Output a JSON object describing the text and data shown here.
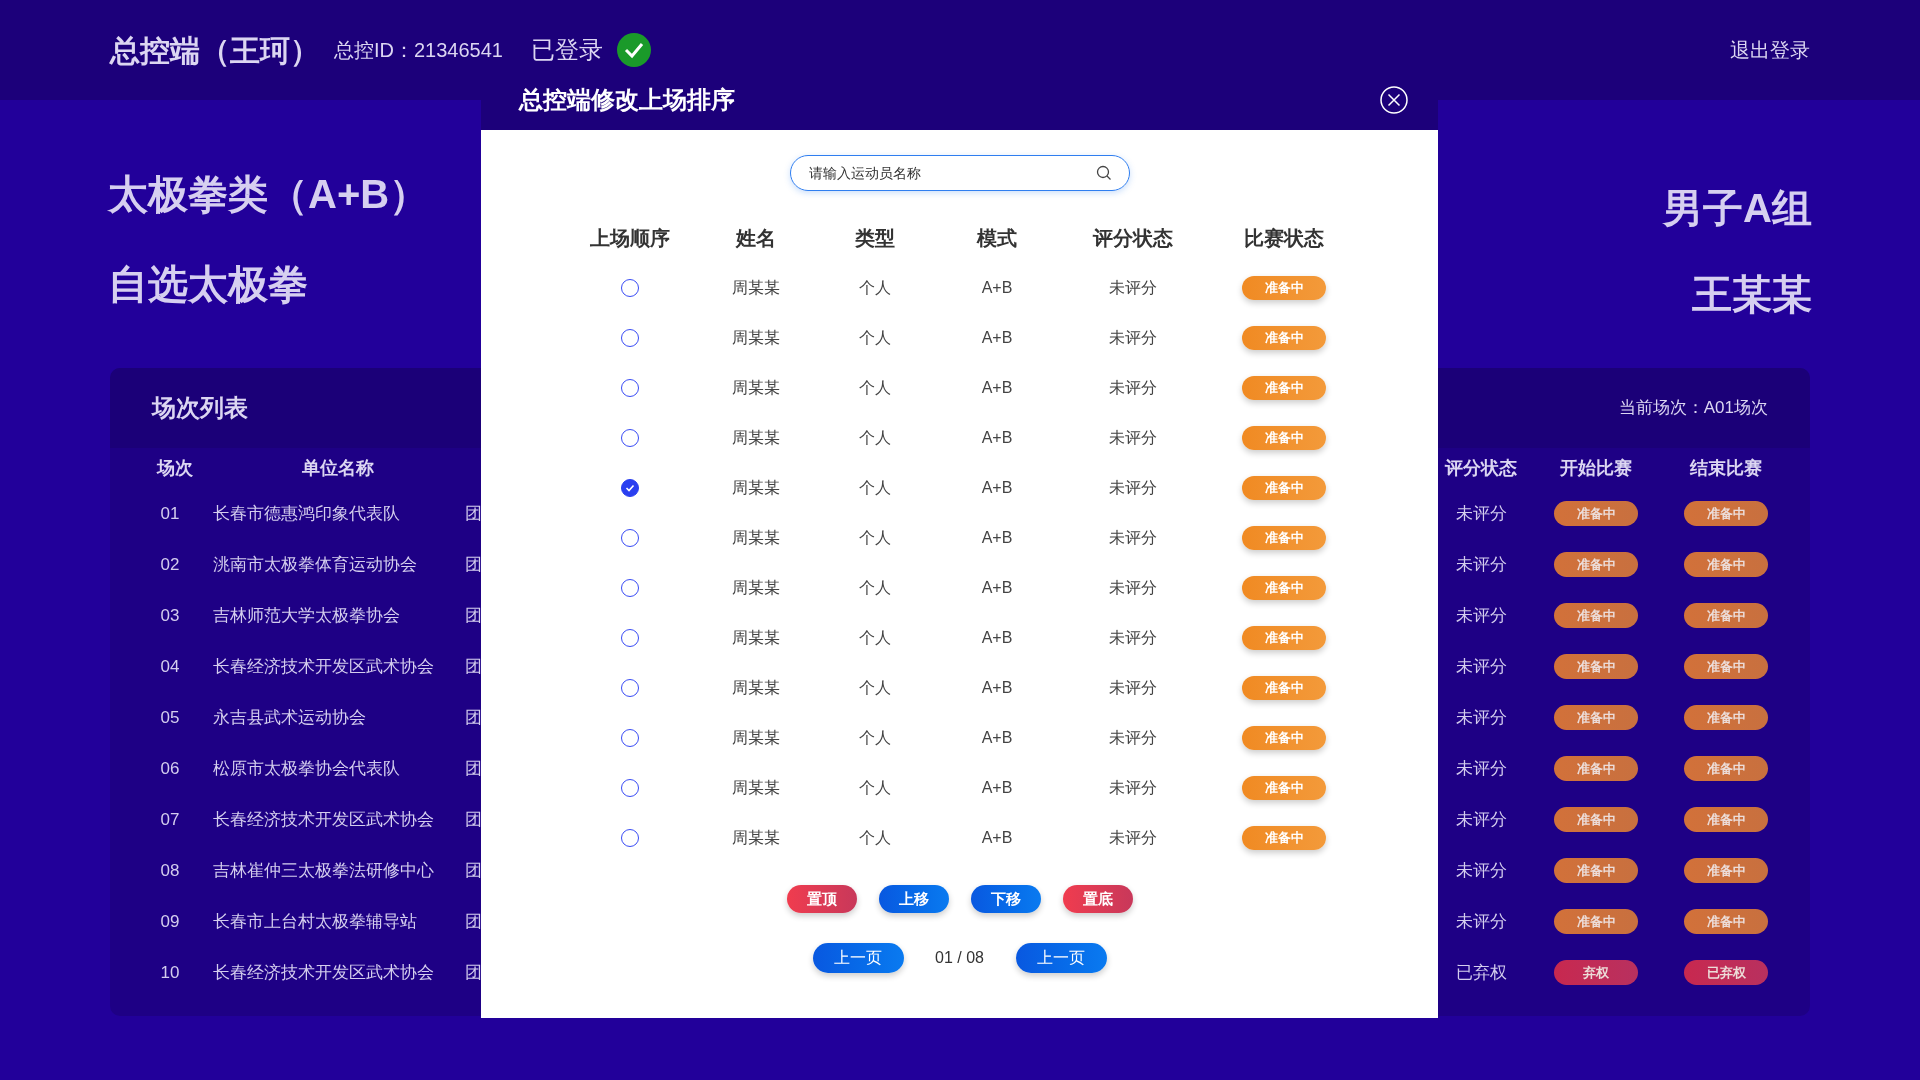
{
  "header": {
    "title": "总控端（王珂）",
    "id_label": "总控ID：21346541",
    "login_status": "已登录",
    "logout": "退出登录"
  },
  "event": {
    "category": "太极拳类（A+B）",
    "routine": "自选太极拳",
    "group": "男子A组",
    "athlete": "王某某"
  },
  "panel": {
    "title": "场次列表",
    "current": "当前场次：A01场次",
    "left_columns": [
      "场次",
      "单位名称"
    ],
    "right_columns": [
      "评分状态",
      "开始比赛",
      "结束比赛"
    ],
    "rows": [
      {
        "no": "01",
        "unit": "长春市德惠鸿印象代表队",
        "column_3": "团",
        "score_status": "未评分",
        "start": {
          "label": "准备中",
          "kind": "ready"
        },
        "end": {
          "label": "准备中",
          "kind": "ready"
        }
      },
      {
        "no": "02",
        "unit": "洮南市太极拳体育运动协会",
        "column_3": "团",
        "score_status": "未评分",
        "start": {
          "label": "准备中",
          "kind": "ready"
        },
        "end": {
          "label": "准备中",
          "kind": "ready"
        }
      },
      {
        "no": "03",
        "unit": "吉林师范大学太极拳协会",
        "column_3": "团",
        "score_status": "未评分",
        "start": {
          "label": "准备中",
          "kind": "ready"
        },
        "end": {
          "label": "准备中",
          "kind": "ready"
        }
      },
      {
        "no": "04",
        "unit": "长春经济技术开发区武术协会",
        "column_3": "团",
        "score_status": "未评分",
        "start": {
          "label": "准备中",
          "kind": "ready"
        },
        "end": {
          "label": "准备中",
          "kind": "ready"
        }
      },
      {
        "no": "05",
        "unit": "永吉县武术运动协会",
        "column_3": "团",
        "score_status": "未评分",
        "start": {
          "label": "准备中",
          "kind": "ready"
        },
        "end": {
          "label": "准备中",
          "kind": "ready"
        }
      },
      {
        "no": "06",
        "unit": "松原市太极拳协会代表队",
        "column_3": "团",
        "score_status": "未评分",
        "start": {
          "label": "准备中",
          "kind": "ready"
        },
        "end": {
          "label": "准备中",
          "kind": "ready"
        }
      },
      {
        "no": "07",
        "unit": "长春经济技术开发区武术协会",
        "column_3": "团",
        "score_status": "未评分",
        "start": {
          "label": "准备中",
          "kind": "ready"
        },
        "end": {
          "label": "准备中",
          "kind": "ready"
        }
      },
      {
        "no": "08",
        "unit": "吉林崔仲三太极拳法研修中心",
        "column_3": "团",
        "score_status": "未评分",
        "start": {
          "label": "准备中",
          "kind": "ready"
        },
        "end": {
          "label": "准备中",
          "kind": "ready"
        }
      },
      {
        "no": "09",
        "unit": "长春市上台村太极拳辅导站",
        "column_3": "团",
        "score_status": "未评分",
        "start": {
          "label": "准备中",
          "kind": "ready"
        },
        "end": {
          "label": "准备中",
          "kind": "ready"
        }
      },
      {
        "no": "10",
        "unit": "长春经济技术开发区武术协会",
        "column_3": "团",
        "score_status": "已弃权",
        "start": {
          "label": "弃权",
          "kind": "forfeit"
        },
        "end": {
          "label": "已弃权",
          "kind": "forfeit"
        }
      }
    ]
  },
  "dialog": {
    "title": "总控端修改上场排序",
    "search": {
      "placeholder": "请输入运动员名称"
    },
    "columns": [
      "上场顺序",
      "姓名",
      "类型",
      "模式",
      "评分状态",
      "比赛状态"
    ],
    "rows": [
      {
        "selected": false,
        "name": "周某某",
        "type": "个人",
        "mode": "A+B",
        "score_status": "未评分",
        "match_status": "准备中"
      },
      {
        "selected": false,
        "name": "周某某",
        "type": "个人",
        "mode": "A+B",
        "score_status": "未评分",
        "match_status": "准备中"
      },
      {
        "selected": false,
        "name": "周某某",
        "type": "个人",
        "mode": "A+B",
        "score_status": "未评分",
        "match_status": "准备中"
      },
      {
        "selected": false,
        "name": "周某某",
        "type": "个人",
        "mode": "A+B",
        "score_status": "未评分",
        "match_status": "准备中"
      },
      {
        "selected": true,
        "name": "周某某",
        "type": "个人",
        "mode": "A+B",
        "score_status": "未评分",
        "match_status": "准备中"
      },
      {
        "selected": false,
        "name": "周某某",
        "type": "个人",
        "mode": "A+B",
        "score_status": "未评分",
        "match_status": "准备中"
      },
      {
        "selected": false,
        "name": "周某某",
        "type": "个人",
        "mode": "A+B",
        "score_status": "未评分",
        "match_status": "准备中"
      },
      {
        "selected": false,
        "name": "周某某",
        "type": "个人",
        "mode": "A+B",
        "score_status": "未评分",
        "match_status": "准备中"
      },
      {
        "selected": false,
        "name": "周某某",
        "type": "个人",
        "mode": "A+B",
        "score_status": "未评分",
        "match_status": "准备中"
      },
      {
        "selected": false,
        "name": "周某某",
        "type": "个人",
        "mode": "A+B",
        "score_status": "未评分",
        "match_status": "准备中"
      },
      {
        "selected": false,
        "name": "周某某",
        "type": "个人",
        "mode": "A+B",
        "score_status": "未评分",
        "match_status": "准备中"
      },
      {
        "selected": false,
        "name": "周某某",
        "type": "个人",
        "mode": "A+B",
        "score_status": "未评分",
        "match_status": "准备中"
      }
    ],
    "actions": [
      {
        "label": "置顶",
        "kind": "danger"
      },
      {
        "label": "上移",
        "kind": "primary"
      },
      {
        "label": "下移",
        "kind": "primary"
      },
      {
        "label": "置底",
        "kind": "danger"
      }
    ],
    "pagination": {
      "prev": "上一页",
      "page": "01 / 08",
      "next": "上一页"
    }
  }
}
